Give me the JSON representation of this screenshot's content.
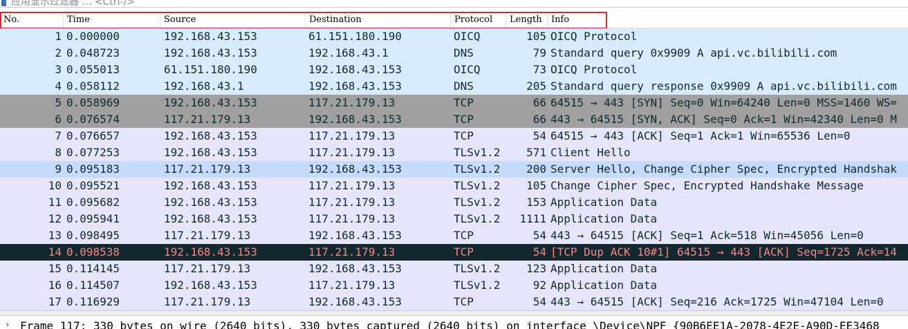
{
  "filter": {
    "placeholder": "应用显示过滤器 … <Ctrl-/>"
  },
  "columns": {
    "no": "No.",
    "time": "Time",
    "source": "Source",
    "destination": "Destination",
    "protocol": "Protocol",
    "length": "Length",
    "info": "Info"
  },
  "packets": [
    {
      "no": "1",
      "time": "0.000000",
      "src": "192.168.43.153",
      "dst": "61.151.180.190",
      "proto": "OICQ",
      "len": "105",
      "info": "OICQ Protocol",
      "style": "oicq"
    },
    {
      "no": "2",
      "time": "0.048723",
      "src": "192.168.43.153",
      "dst": "192.168.43.1",
      "proto": "DNS",
      "len": "79",
      "info": "Standard query 0x9909 A api.vc.bilibili.com",
      "style": "dns"
    },
    {
      "no": "3",
      "time": "0.055013",
      "src": "61.151.180.190",
      "dst": "192.168.43.153",
      "proto": "OICQ",
      "len": "73",
      "info": "OICQ Protocol",
      "style": "oicq"
    },
    {
      "no": "4",
      "time": "0.058112",
      "src": "192.168.43.1",
      "dst": "192.168.43.153",
      "proto": "DNS",
      "len": "205",
      "info": "Standard query response 0x9909 A api.vc.bilibili.com",
      "style": "dns"
    },
    {
      "no": "5",
      "time": "0.058969",
      "src": "192.168.43.153",
      "dst": "117.21.179.13",
      "proto": "TCP",
      "len": "66",
      "info": "64515 → 443 [SYN] Seq=0 Win=64240 Len=0 MSS=1460 WS=",
      "style": "syn"
    },
    {
      "no": "6",
      "time": "0.076574",
      "src": "117.21.179.13",
      "dst": "192.168.43.153",
      "proto": "TCP",
      "len": "66",
      "info": "443 → 64515 [SYN, ACK] Seq=0 Ack=1 Win=42340 Len=0 M",
      "style": "syn"
    },
    {
      "no": "7",
      "time": "0.076657",
      "src": "192.168.43.153",
      "dst": "117.21.179.13",
      "proto": "TCP",
      "len": "54",
      "info": "64515 → 443 [ACK] Seq=1 Ack=1 Win=65536 Len=0",
      "style": "tcp"
    },
    {
      "no": "8",
      "time": "0.077253",
      "src": "192.168.43.153",
      "dst": "117.21.179.13",
      "proto": "TLSv1.2",
      "len": "571",
      "info": "Client Hello",
      "style": "tls"
    },
    {
      "no": "9",
      "time": "0.095183",
      "src": "117.21.179.13",
      "dst": "192.168.43.153",
      "proto": "TLSv1.2",
      "len": "200",
      "info": "Server Hello, Change Cipher Spec, Encrypted Handshak",
      "style": "sel"
    },
    {
      "no": "10",
      "time": "0.095521",
      "src": "192.168.43.153",
      "dst": "117.21.179.13",
      "proto": "TLSv1.2",
      "len": "105",
      "info": "Change Cipher Spec, Encrypted Handshake Message",
      "style": "tls"
    },
    {
      "no": "11",
      "time": "0.095682",
      "src": "192.168.43.153",
      "dst": "117.21.179.13",
      "proto": "TLSv1.2",
      "len": "153",
      "info": "Application Data",
      "style": "tls"
    },
    {
      "no": "12",
      "time": "0.095941",
      "src": "192.168.43.153",
      "dst": "117.21.179.13",
      "proto": "TLSv1.2",
      "len": "1111",
      "info": "Application Data",
      "style": "tls"
    },
    {
      "no": "13",
      "time": "0.098495",
      "src": "117.21.179.13",
      "dst": "192.168.43.153",
      "proto": "TCP",
      "len": "54",
      "info": "443 → 64515 [ACK] Seq=1 Ack=518 Win=45056 Len=0",
      "style": "tcp"
    },
    {
      "no": "14",
      "time": "0.098538",
      "src": "192.168.43.153",
      "dst": "117.21.179.13",
      "proto": "TCP",
      "len": "54",
      "info": "[TCP Dup ACK 10#1] 64515 → 443 [ACK] Seq=1725 Ack=14",
      "style": "bad"
    },
    {
      "no": "15",
      "time": "0.114145",
      "src": "117.21.179.13",
      "dst": "192.168.43.153",
      "proto": "TLSv1.2",
      "len": "123",
      "info": "Application Data",
      "style": "tls"
    },
    {
      "no": "16",
      "time": "0.114507",
      "src": "192.168.43.153",
      "dst": "117.21.179.13",
      "proto": "TLSv1.2",
      "len": "92",
      "info": "Application Data",
      "style": "tls"
    },
    {
      "no": "17",
      "time": "0.116929",
      "src": "117.21.179.13",
      "dst": "192.168.43.153",
      "proto": "TCP",
      "len": "54",
      "info": "443 → 64515 [ACK] Seq=216 Ack=1725 Win=47104 Len=0",
      "style": "tcp"
    }
  ],
  "detail": {
    "expander": "›",
    "text": "Frame 117: 330 bytes on wire (2640 bits), 330 bytes captured (2640 bits) on interface \\Device\\NPF_{90B6EE1A-2078-4E2E-A90D-EE3468"
  },
  "colors": {
    "highlight_border": "#e8202a",
    "udp_bg": "#d9ecff",
    "tcp_bg": "#e6e6fa",
    "syn_bg": "#a0a0a0",
    "selected_bg": "#c7dafc",
    "bad_bg": "#12272e",
    "bad_fg": "#f78787"
  }
}
